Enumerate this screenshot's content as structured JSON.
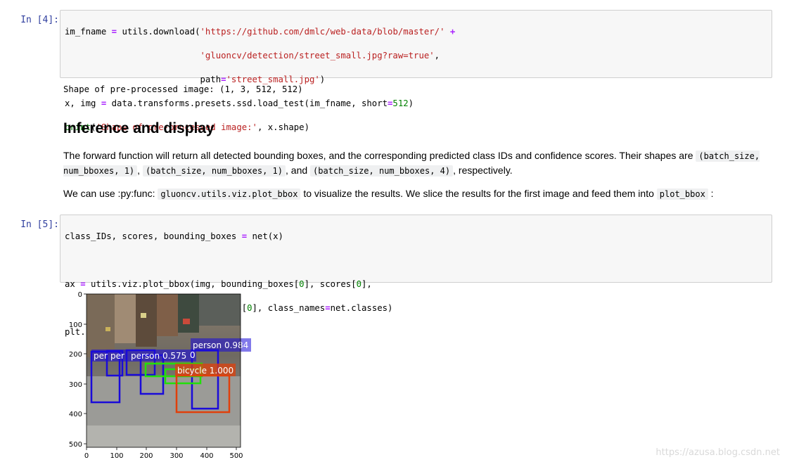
{
  "cells": [
    {
      "prompt": "In  [4]:",
      "lines": [
        "im_fname = utils.download('https://github.com/dmlc/web-data/blob/master/' +",
        "                          'gluoncv/detection/street_small.jpg?raw=true',",
        "                          path='street_small.jpg')",
        "x, img = data.transforms.presets.ssd.load_test(im_fname, short=512)",
        "print('Shape of pre-processed image:', x.shape)"
      ],
      "output": "Shape of pre-processed image: (1, 3, 512, 512)"
    },
    {
      "prompt": "In  [5]:",
      "lines": [
        "class_IDs, scores, bounding_boxes = net(x)",
        "",
        "ax = utils.viz.plot_bbox(img, bounding_boxes[0], scores[0],",
        "                         class_IDs[0], class_names=net.classes)",
        "plt.show()"
      ]
    }
  ],
  "markdown": {
    "heading": "Inference and display",
    "para1": {
      "t1": "The forward function will return all detected bounding boxes, and the corresponding predicted class IDs and confidence scores. Their shapes are ",
      "c1": "(batch_size, num_bboxes, 1)",
      "t2": ", ",
      "c2": "(batch_size, num_bboxes, 1)",
      "t3": ", and ",
      "c3": "(batch_size, num_bboxes, 4)",
      "t4": ", respectively."
    },
    "para2": {
      "t1": "We can use :py:func: ",
      "c1": "gluoncv.utils.viz.plot_bbox",
      "t2": " to visualize the results. We slice the results for the first image and feed them into ",
      "c2": "plot_bbox",
      "t3": " :"
    }
  },
  "plot": {
    "x_ticks": [
      "0",
      "100",
      "200",
      "300",
      "400",
      "500"
    ],
    "y_ticks": [
      "0",
      "100",
      "200",
      "300",
      "400",
      "500"
    ],
    "detections": [
      {
        "label": "person 0.984",
        "color": "#1a0bd9"
      },
      {
        "label": "bicycle 1.000",
        "color": "#e0400b"
      },
      {
        "label": "person 0.575",
        "color": "#1a0bd9"
      },
      {
        "label": "per",
        "color": "#1a0bd9"
      },
      {
        "label": "per",
        "color": "#1a0bd9"
      },
      {
        "label": "0",
        "color": "#1a0bd9"
      },
      {
        "label": "",
        "color": "#22e00a"
      }
    ]
  },
  "watermark": "https://azusa.blog.csdn.net"
}
